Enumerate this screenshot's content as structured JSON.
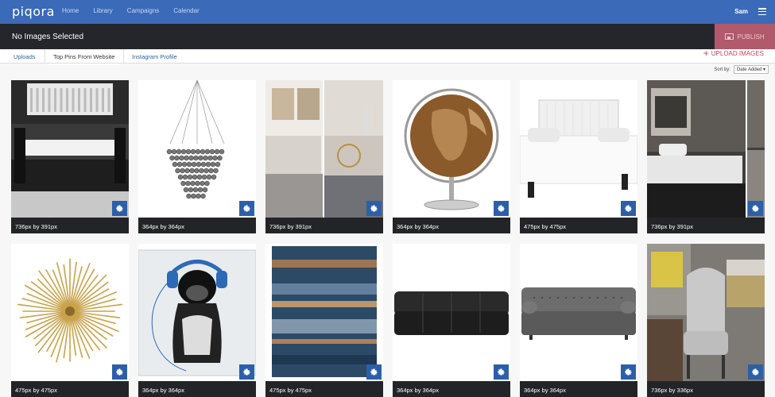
{
  "nav": {
    "logo": "piqora",
    "links": [
      "Home",
      "Library",
      "Campaigns",
      "Calendar"
    ],
    "user": "Sam"
  },
  "selection": {
    "status": "No Images Selected",
    "publish_label": "PUBLISH"
  },
  "tabs": [
    {
      "label": "Uploads",
      "active": false
    },
    {
      "label": "Top Pins From Website",
      "active": true
    },
    {
      "label": "Instagram Profile",
      "active": false
    }
  ],
  "upload_label": "UPLOAD IMAGES",
  "sort": {
    "label": "Sort by:",
    "value": "Date Added"
  },
  "colors": {
    "nav": "#3a6ab8",
    "accent": "#c8435e",
    "gear": "#2c5fa8"
  },
  "images": [
    {
      "size": "736px by 391px",
      "subject": "dining-room"
    },
    {
      "size": "364px by 364px",
      "subject": "crystal-chandelier"
    },
    {
      "size": "736px by 391px",
      "subject": "living-room"
    },
    {
      "size": "364px by 364px",
      "subject": "copper-globe"
    },
    {
      "size": "475px by 475px",
      "subject": "white-bed"
    },
    {
      "size": "736px by 391px",
      "subject": "dark-bedroom"
    },
    {
      "size": "475px by 475px",
      "subject": "gold-starburst"
    },
    {
      "size": "364px by 364px",
      "subject": "pug-headphones-print"
    },
    {
      "size": "475px by 475px",
      "subject": "abstract-rug"
    },
    {
      "size": "364px by 364px",
      "subject": "black-sectional-sofa"
    },
    {
      "size": "364px by 364px",
      "subject": "grey-tufted-sofa"
    },
    {
      "size": "736px by 336px",
      "subject": "grey-chair-room"
    }
  ]
}
